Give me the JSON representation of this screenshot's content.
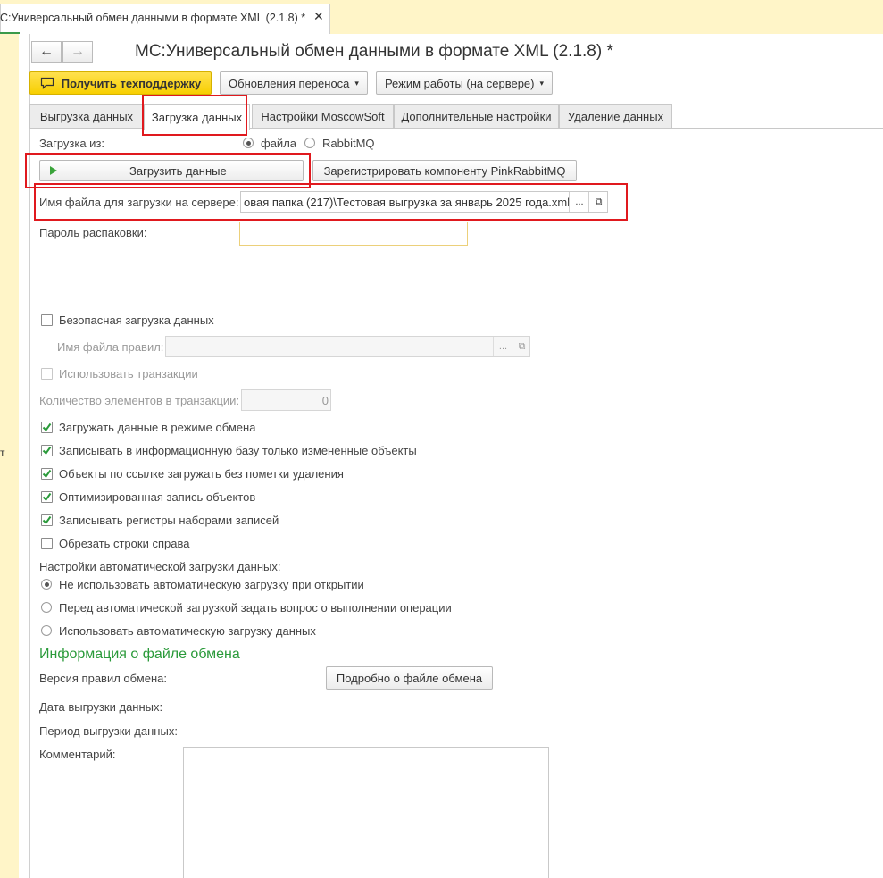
{
  "doc_tab": {
    "title": "С:Универсальный обмен данными в формате XML (2.1.8) *",
    "close": "✕"
  },
  "left_panel_char": "т",
  "form": {
    "title": "МС:Универсальный обмен данными в формате XML (2.1.8) *",
    "back_glyph": "←",
    "forward_glyph": "→"
  },
  "toolbar": {
    "support_label": "Получить техподдержку",
    "updates_label": "Обновления переноса",
    "mode_label": "Режим работы (на сервере)",
    "caret": "▾"
  },
  "tabs": [
    {
      "label": "Выгрузка данных"
    },
    {
      "label": "Загрузка данных"
    },
    {
      "label": "Настройки MoscowSoft"
    },
    {
      "label": "Дополнительные настройки"
    },
    {
      "label": "Удаление данных"
    }
  ],
  "load": {
    "from_label": "Загрузка из:",
    "option_file": "файла",
    "option_rabbit": "RabbitMQ",
    "load_button": "Загрузить данные",
    "register_button": "Зарегистрировать компоненту PinkRabbitMQ",
    "file_label": "Имя файла для загрузки на сервере:",
    "file_value": "овая папка (217)\\Тестовая выгрузка за январь 2025 года.xml",
    "ellipsis": "...",
    "open_glyph": "⧉",
    "password_label": "Пароль распаковки:",
    "safe_load": "Безопасная загрузка данных",
    "rules_file_label": "Имя файла правил:",
    "use_transactions": "Использовать транзакции",
    "tx_count_label": "Количество элементов в транзакции:",
    "tx_count_value": "0"
  },
  "options": [
    {
      "label": "Загружать данные в режиме обмена",
      "checked": true
    },
    {
      "label": "Записывать в информационную базу только измененные объекты",
      "checked": true
    },
    {
      "label": "Объекты по ссылке загружать без пометки удаления",
      "checked": true
    },
    {
      "label": "Оптимизированная запись объектов",
      "checked": true
    },
    {
      "label": "Записывать регистры наборами записей",
      "checked": true
    },
    {
      "label": "Обрезать строки справа",
      "checked": false
    }
  ],
  "auto": {
    "title": "Настройки автоматической загрузки данных:",
    "options": [
      "Не использовать автоматическую загрузку при открытии",
      "Перед автоматической загрузкой задать вопрос о выполнении операции",
      "Использовать автоматическую загрузку данных"
    ],
    "selected": 0
  },
  "info": {
    "heading": "Информация о файле обмена",
    "rules_version_label": "Версия правил обмена:",
    "details_button": "Подробно о файле обмена",
    "export_date_label": "Дата выгрузки данных:",
    "export_period_label": "Период выгрузки данных:",
    "comment_label": "Комментарий:"
  },
  "colors": {
    "accent_green": "#2a9a3a",
    "highlight_red": "#e0191e",
    "support_yellow": "#f7cf00"
  }
}
